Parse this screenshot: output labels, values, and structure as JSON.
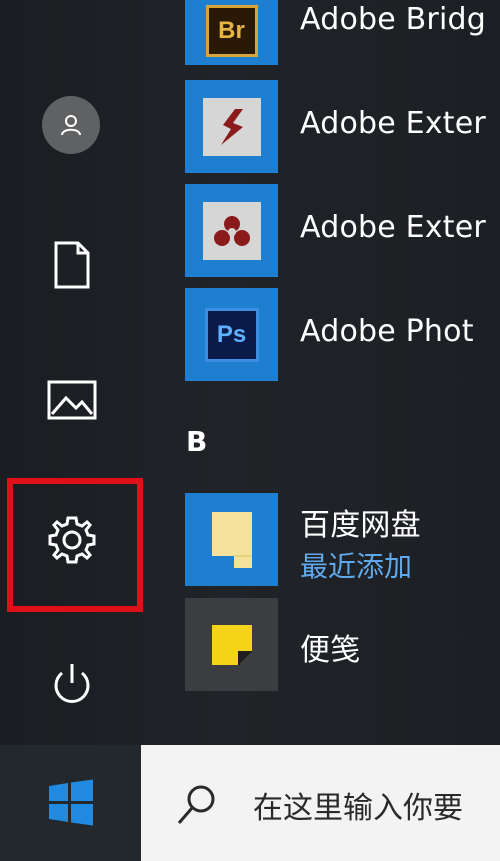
{
  "apps": [
    {
      "label": "Adobe Bridg",
      "icon": "adobe-bridge-icon",
      "badge": "Br"
    },
    {
      "label": "Adobe Exter",
      "icon": "adobe-extension-manager-icon"
    },
    {
      "label": "Adobe Exter",
      "icon": "adobe-extendscript-icon"
    },
    {
      "label": "Adobe Phot",
      "icon": "adobe-photoshop-icon",
      "badge": "Ps"
    },
    {
      "label": "百度网盘",
      "sub": "最近添加",
      "icon": "baidu-netdisk-icon"
    },
    {
      "label": "便笺",
      "icon": "sticky-notes-icon"
    }
  ],
  "section": "B",
  "search": {
    "placeholder": "在这里输入你要"
  },
  "colors": {
    "accent": "#1e7fd1",
    "highlight": "#e0101a",
    "recent": "#5fa8ec"
  }
}
